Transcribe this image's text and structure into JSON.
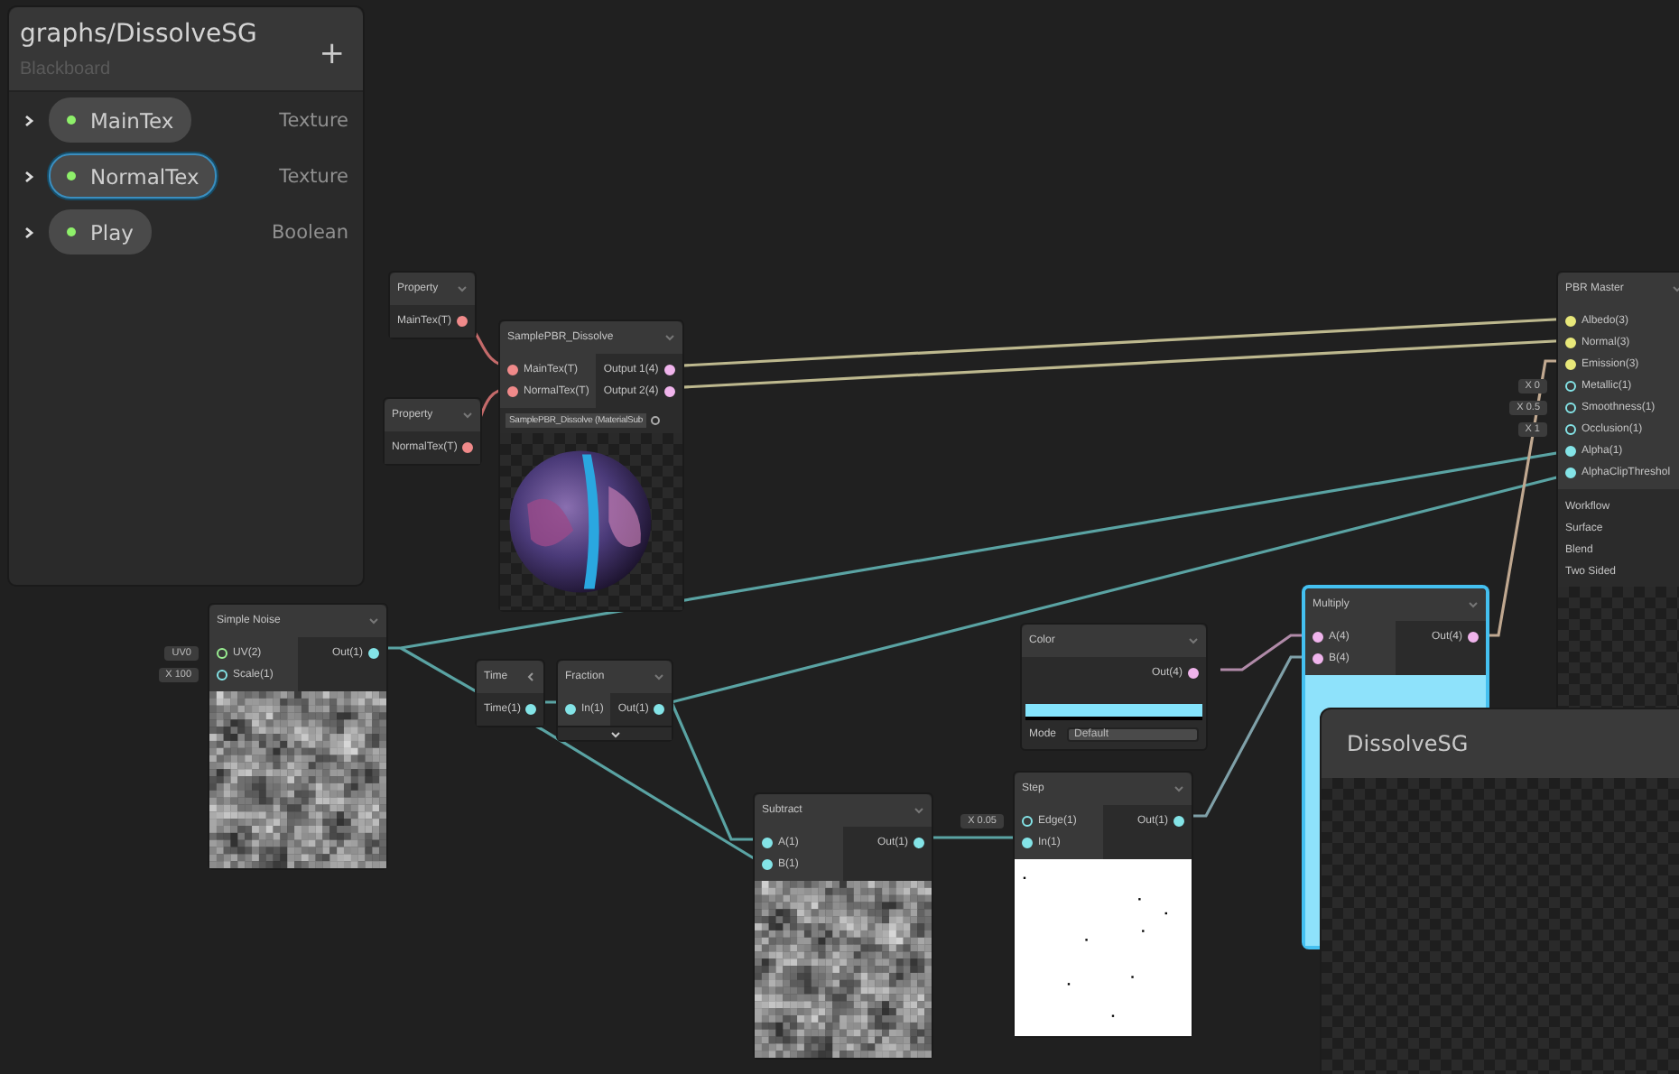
{
  "blackboard": {
    "title": "graphs/DissolveSG",
    "subtitle": "Blackboard",
    "add_button": "+",
    "properties": [
      {
        "name": "MainTex",
        "type": "Texture",
        "selected": false
      },
      {
        "name": "NormalTex",
        "type": "Texture",
        "selected": true
      },
      {
        "name": "Play",
        "type": "Boolean",
        "selected": false
      }
    ]
  },
  "nodes": [
    {
      "title": "Property",
      "selected": false,
      "outputs": [
        {
          "label": "MainTex(T)",
          "color": "#f08a8a",
          "connected": true
        }
      ]
    },
    {
      "title": "Property",
      "selected": false,
      "outputs": [
        {
          "label": "NormalTex(T)",
          "color": "#f08a8a",
          "connected": true
        }
      ]
    },
    {
      "title": "SamplePBR_Dissolve",
      "selected": false,
      "inputs": [
        {
          "label": "MainTex(T)",
          "color": "#f08a8a",
          "connected": true
        },
        {
          "label": "NormalTex(T)",
          "color": "#f08a8a",
          "connected": true
        }
      ],
      "outputs": [
        {
          "label": "Output 1(4)",
          "color": "#f0b4ec",
          "connected": true
        },
        {
          "label": "Output 2(4)",
          "color": "#f0b4ec",
          "connected": true
        }
      ],
      "material_field": "SamplePBR_Dissolve (MaterialSub",
      "preview": {
        "kind": "sphere"
      }
    },
    {
      "title": "Simple Noise",
      "selected": false,
      "inputs": [
        {
          "label": "UV(2)",
          "color": "#9aef92",
          "connected": false,
          "value": "UV0"
        },
        {
          "label": "Scale(1)",
          "color": "#84e4e7",
          "connected": false,
          "value": "X 100"
        }
      ],
      "outputs": [
        {
          "label": "Out(1)",
          "color": "#84e4e7",
          "connected": true
        }
      ],
      "preview": {
        "kind": "noise"
      }
    },
    {
      "title": "Time",
      "selected": false,
      "ports_collapsed": true,
      "outputs": [
        {
          "label": "Time(1)",
          "color": "#84e4e7",
          "connected": true
        }
      ]
    },
    {
      "title": "Fraction",
      "selected": false,
      "preview_collapsed": true,
      "inputs": [
        {
          "label": "In(1)",
          "color": "#84e4e7",
          "connected": true
        }
      ],
      "outputs": [
        {
          "label": "Out(1)",
          "color": "#84e4e7",
          "connected": true
        }
      ]
    },
    {
      "title": "Subtract",
      "selected": false,
      "inputs": [
        {
          "label": "A(1)",
          "color": "#84e4e7",
          "connected": true
        },
        {
          "label": "B(1)",
          "color": "#84e4e7",
          "connected": true
        }
      ],
      "outputs": [
        {
          "label": "Out(1)",
          "color": "#84e4e7",
          "connected": true
        }
      ],
      "preview": {
        "kind": "noise"
      }
    },
    {
      "title": "Color",
      "selected": false,
      "color": "#84e4fc",
      "mode_label": "Mode",
      "mode": "Default",
      "outputs": [
        {
          "label": "Out(4)",
          "color": "#f0b4ec",
          "connected": true
        }
      ]
    },
    {
      "title": "Step",
      "selected": false,
      "inputs": [
        {
          "label": "Edge(1)",
          "color": "#84e4e7",
          "connected": false,
          "value": "X 0.05"
        },
        {
          "label": "In(1)",
          "color": "#84e4e7",
          "connected": true
        }
      ],
      "outputs": [
        {
          "label": "Out(1)",
          "color": "#84e4e7",
          "connected": true
        }
      ],
      "preview": {
        "kind": "step"
      }
    },
    {
      "title": "Multiply",
      "selected": true,
      "inputs": [
        {
          "label": "A(4)",
          "color": "#f0b4ec",
          "connected": true
        },
        {
          "label": "B(4)",
          "color": "#f0b4ec",
          "connected": true
        }
      ],
      "outputs": [
        {
          "label": "Out(4)",
          "color": "#f0b4ec",
          "connected": true
        }
      ],
      "preview": {
        "kind": "solid",
        "color": "#8ee2fb"
      }
    },
    {
      "title": "PBR Master",
      "selected": false,
      "inputs": [
        {
          "label": "Albedo(3)",
          "color": "#e8e87a",
          "connected": true
        },
        {
          "label": "Normal(3)",
          "color": "#e8e87a",
          "connected": true
        },
        {
          "label": "Emission(3)",
          "color": "#e8e87a",
          "connected": true
        },
        {
          "label": "Metallic(1)",
          "color": "#84e4e7",
          "connected": false,
          "value": "X 0"
        },
        {
          "label": "Smoothness(1)",
          "color": "#84e4e7",
          "connected": false,
          "value": "X 0.5"
        },
        {
          "label": "Occlusion(1)",
          "color": "#84e4e7",
          "connected": false,
          "value": "X 1"
        },
        {
          "label": "Alpha(1)",
          "color": "#84e4e7",
          "connected": true
        },
        {
          "label": "AlphaClipThreshol",
          "color": "#84e4e7",
          "connected": true
        }
      ],
      "settings": [
        "Workflow",
        "Surface",
        "Blend",
        "Two Sided"
      ],
      "preview": {
        "kind": "checker"
      }
    }
  ],
  "preview_window": {
    "title": "DissolveSG"
  }
}
